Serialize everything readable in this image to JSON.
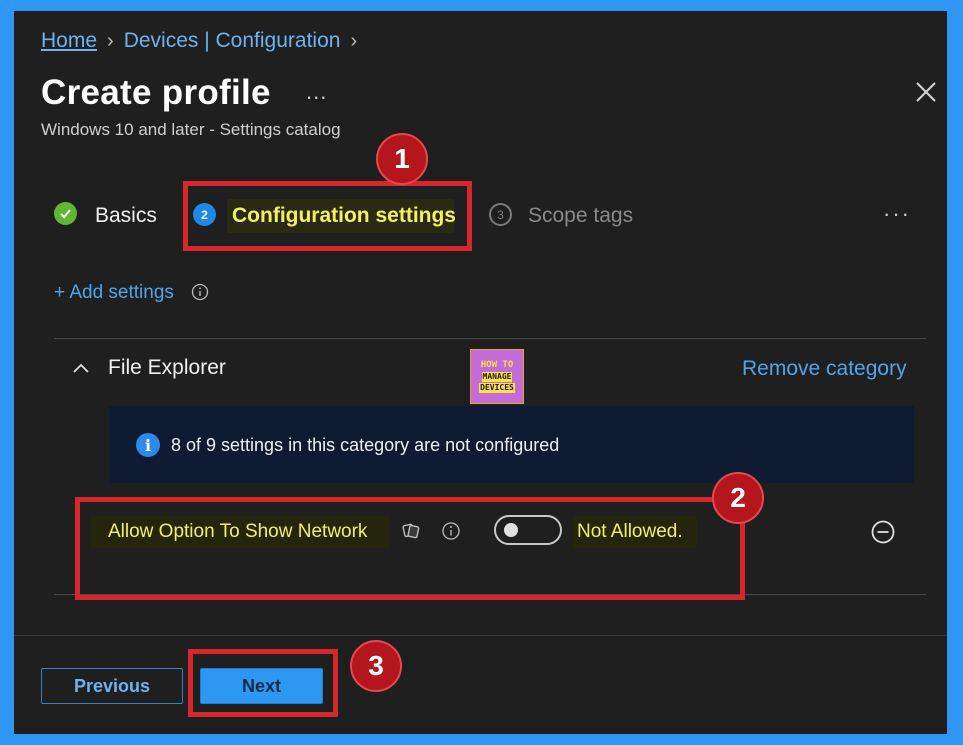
{
  "breadcrumb": {
    "home": "Home",
    "devices": "Devices | Configuration"
  },
  "header": {
    "title": "Create profile",
    "more": "...",
    "subtitle": "Windows 10 and later - Settings catalog"
  },
  "steps": [
    {
      "label": "Basics",
      "status": "completed"
    },
    {
      "number": "2",
      "label": "Configuration settings",
      "status": "active"
    },
    {
      "number": "3",
      "label": "Scope tags",
      "status": "upcoming"
    }
  ],
  "steps_more": "···",
  "add_settings": "+ Add settings",
  "category": {
    "title": "File Explorer",
    "remove_label": "Remove category",
    "banner_text": "8 of 9 settings in this category are not configured"
  },
  "setting": {
    "label": "Allow Option To Show Network",
    "toggle_value": "Not Allowed.",
    "toggle_on": false
  },
  "logo": {
    "line1": "HOW TO",
    "line2": "MANAGE",
    "line3": "DEVICES"
  },
  "footer": {
    "previous_label": "Previous",
    "next_label": "Next"
  },
  "annotations": [
    "1",
    "2",
    "3"
  ],
  "colors": {
    "frame": "#2f96f3",
    "panel": "#1f1f1f",
    "accent": "#4ea5ec",
    "highlight_text": "#f3f25a",
    "annotation_red": "#d8262d"
  }
}
